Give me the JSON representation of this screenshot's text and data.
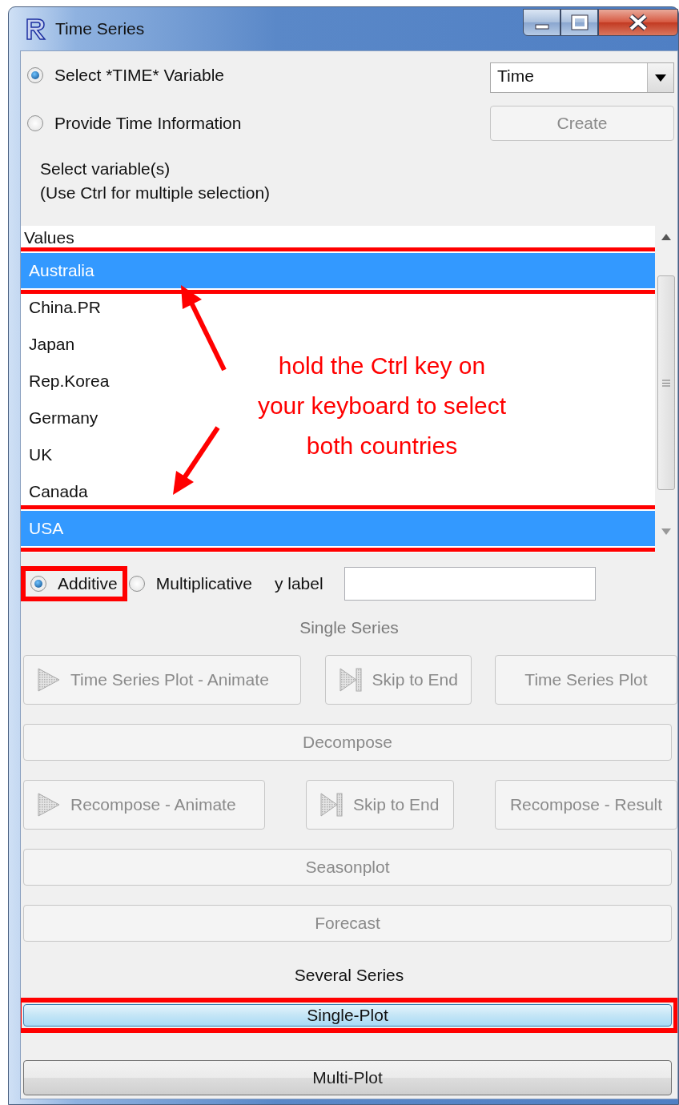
{
  "window": {
    "title": "Time Series"
  },
  "time_source": {
    "options": [
      {
        "label": "Select *TIME* Variable",
        "selected": true
      },
      {
        "label": "Provide Time Information",
        "selected": false
      }
    ],
    "dropdown": {
      "value": "Time"
    },
    "create_button": {
      "label": "Create",
      "disabled": true
    }
  },
  "instructions": [
    "Select variable(s)",
    "(Use Ctrl for multiple selection)"
  ],
  "variable_list": {
    "header": "Values",
    "items": [
      {
        "label": "Australia",
        "selected": true,
        "highlighted": true
      },
      {
        "label": "China.PR",
        "selected": false,
        "highlighted": false
      },
      {
        "label": "Japan",
        "selected": false,
        "highlighted": false
      },
      {
        "label": "Rep.Korea",
        "selected": false,
        "highlighted": false
      },
      {
        "label": "Germany",
        "selected": false,
        "highlighted": false
      },
      {
        "label": "UK",
        "selected": false,
        "highlighted": false
      },
      {
        "label": "Canada",
        "selected": false,
        "highlighted": false
      },
      {
        "label": "USA",
        "selected": true,
        "highlighted": true
      }
    ]
  },
  "annotation": {
    "lines": [
      "hold the Ctrl key on",
      "your keyboard to select",
      "both countries"
    ]
  },
  "model": {
    "options": [
      {
        "label": "Additive",
        "selected": true,
        "highlighted": true
      },
      {
        "label": "Multiplicative",
        "selected": false,
        "highlighted": false
      }
    ],
    "y_label_field": {
      "label": "y label"
    }
  },
  "single_series": {
    "heading": "Single Series",
    "disabled": true,
    "rows": [
      [
        {
          "label": "Time Series Plot - Animate",
          "kind": "play",
          "disabled": true
        },
        {
          "label": "Skip to End",
          "kind": "skip",
          "disabled": true
        },
        {
          "label": "Time Series Plot",
          "kind": "plain",
          "disabled": true
        }
      ],
      [
        {
          "label": "Decompose",
          "kind": "plain",
          "disabled": true
        }
      ],
      [
        {
          "label": "Recompose - Animate",
          "kind": "play",
          "disabled": true
        },
        {
          "label": "Skip to End",
          "kind": "skip",
          "disabled": true
        },
        {
          "label": "Recompose - Result",
          "kind": "plain",
          "disabled": true
        }
      ],
      [
        {
          "label": "Seasonplot",
          "kind": "plain",
          "disabled": true
        }
      ],
      [
        {
          "label": "Forecast",
          "kind": "plain",
          "disabled": true
        }
      ]
    ]
  },
  "several_series": {
    "heading": "Several Series",
    "disabled": false,
    "buttons": [
      {
        "label": "Single-Plot",
        "disabled": false,
        "focused": true,
        "highlighted": true
      },
      {
        "label": "Multi-Plot",
        "disabled": false,
        "focused": false,
        "highlighted": false
      }
    ]
  }
}
